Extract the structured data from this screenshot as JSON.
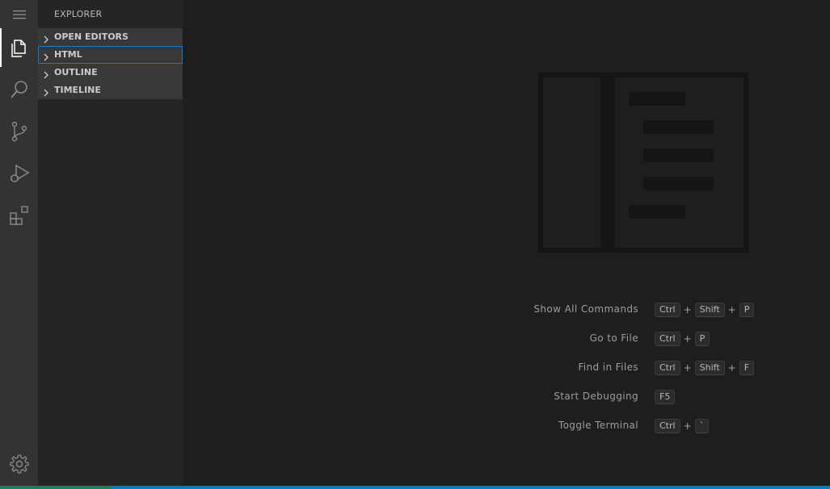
{
  "activity_bar": {
    "items": [
      {
        "name": "menu",
        "icon": "hamburger-menu-icon"
      },
      {
        "name": "explorer",
        "icon": "files-icon",
        "active": true
      },
      {
        "name": "search",
        "icon": "search-icon"
      },
      {
        "name": "source-control",
        "icon": "source-control-icon"
      },
      {
        "name": "run-debug",
        "icon": "run-debug-icon"
      },
      {
        "name": "extensions",
        "icon": "extensions-icon"
      }
    ],
    "manage": {
      "name": "manage",
      "icon": "gear-icon"
    }
  },
  "sidebar": {
    "title": "EXPLORER",
    "sections": [
      {
        "label": "OPEN EDITORS",
        "expanded": false
      },
      {
        "label": "HTML",
        "expanded": false,
        "focused": true
      },
      {
        "label": "OUTLINE",
        "expanded": false
      },
      {
        "label": "TIMELINE",
        "expanded": false
      }
    ]
  },
  "editor": {
    "watermark_icon": "vscode-letterpress-icon",
    "shortcuts": [
      {
        "label": "Show All Commands",
        "keys": [
          "Ctrl",
          "Shift",
          "P"
        ]
      },
      {
        "label": "Go to File",
        "keys": [
          "Ctrl",
          "P"
        ]
      },
      {
        "label": "Find in Files",
        "keys": [
          "Ctrl",
          "Shift",
          "F"
        ]
      },
      {
        "label": "Start Debugging",
        "keys": [
          "F5"
        ]
      },
      {
        "label": "Toggle Terminal",
        "keys": [
          "Ctrl",
          "`"
        ]
      }
    ]
  },
  "status_bar": {
    "background": "#007acc",
    "remote_background": "#16825d"
  },
  "colors": {
    "activity_bar_bg": "#333333",
    "sidebar_bg": "#252526",
    "editor_bg": "#1e1e1e",
    "focus_border": "#007fd4"
  }
}
